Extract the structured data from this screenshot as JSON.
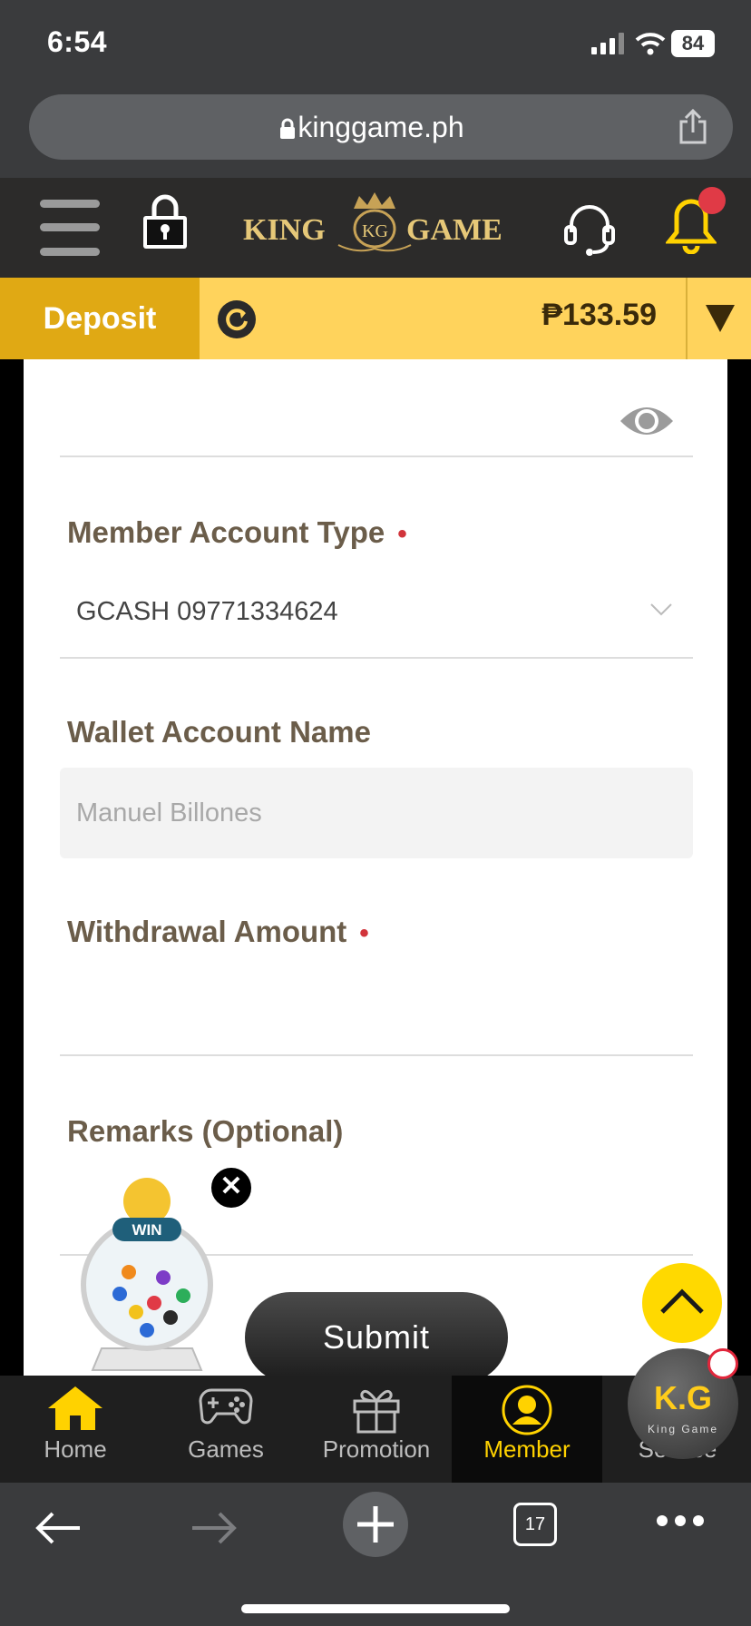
{
  "status_bar": {
    "time": "6:54",
    "battery": "84"
  },
  "browser": {
    "url": "kinggame.ph",
    "tab_count": "17"
  },
  "header": {
    "logo_left": "KING",
    "logo_mid": "KG",
    "logo_right": "GAME"
  },
  "deposit_bar": {
    "deposit_label": "Deposit",
    "balance": "₱133.59"
  },
  "form": {
    "account_type_label": "Member Account Type",
    "account_type_value": "GCASH 09771334624",
    "wallet_name_label": "Wallet Account Name",
    "wallet_name_value": "Manuel Billones",
    "amount_label": "Withdrawal Amount",
    "remarks_label": "Remarks (Optional)",
    "required_mark": "•",
    "submit_label": "Submit"
  },
  "win_widget": {
    "label": "WIN",
    "close": "✕"
  },
  "bottom_nav": {
    "items": [
      {
        "label": "Home"
      },
      {
        "label": "Games"
      },
      {
        "label": "Promotion"
      },
      {
        "label": "Member"
      },
      {
        "label": "Service"
      }
    ],
    "badge_text": "K.G",
    "badge_sub": "King Game"
  },
  "colors": {
    "accent": "#ffd35c",
    "deposit": "#e0a914",
    "active": "#ffd200",
    "required": "#d1343b"
  }
}
